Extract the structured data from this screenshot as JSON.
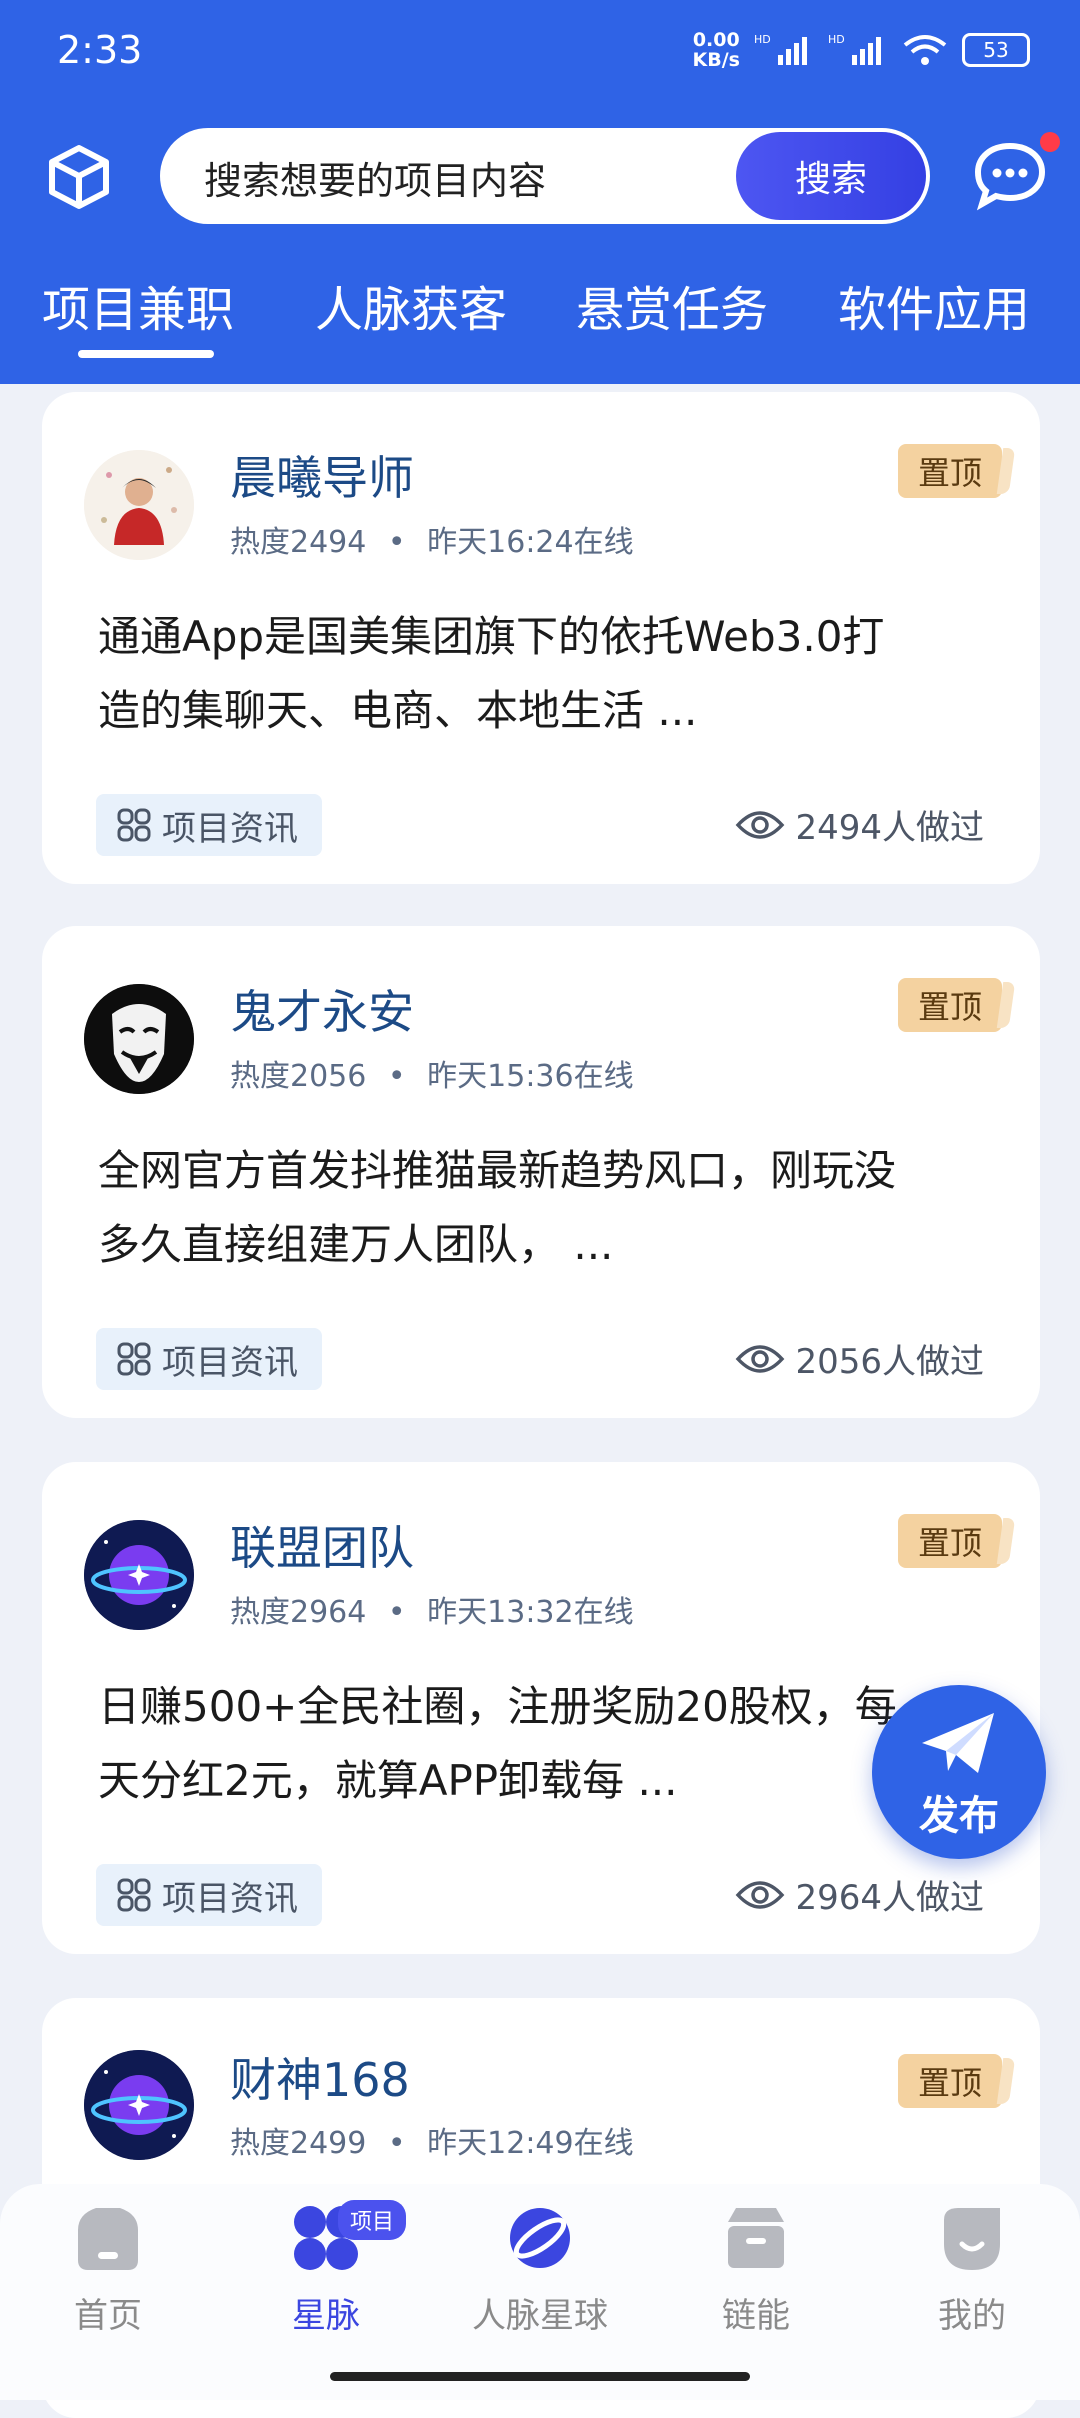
{
  "status_bar": {
    "time": "2:33",
    "net_speed_value": "0.00",
    "net_speed_unit": "KB/s",
    "signal1_label": "HD",
    "signal2_label": "HD",
    "battery": "53"
  },
  "search": {
    "placeholder": "搜索想要的项目内容",
    "button_label": "搜索"
  },
  "tabs": [
    "项目兼职",
    "人脉获客",
    "悬赏任务",
    "软件应用"
  ],
  "cards": [
    {
      "name": "晨曦导师",
      "heat": "热度2494",
      "separator": "•",
      "online": "昨天16:24在线",
      "pin": "置顶",
      "desc_line1": "通通App是国美集团旗下的依托Web3.0打",
      "desc_line2": "造的集聊天、电商、本地生活 ...",
      "tag": "项目资讯",
      "views": "2494人做过"
    },
    {
      "name": "鬼才永安",
      "heat": "热度2056",
      "separator": "•",
      "online": "昨天15:36在线",
      "pin": "置顶",
      "desc_line1": "全网官方首发抖推猫最新趋势风口，刚玩没",
      "desc_line2": "多久直接组建万人团队， ...",
      "tag": "项目资讯",
      "views": "2056人做过"
    },
    {
      "name": "联盟团队",
      "heat": "热度2964",
      "separator": "•",
      "online": "昨天13:32在线",
      "pin": "置顶",
      "desc_line1": "日赚500+全民社圈，注册奖励20股权，每",
      "desc_line2": "天分红2元，就算APP卸载每 ...",
      "tag": "项目资讯",
      "views": "2964人做过"
    },
    {
      "name": "财神168",
      "heat": "热度2499",
      "separator": "•",
      "online": "昨天12:49在线",
      "pin": "置顶"
    }
  ],
  "fab": {
    "label": "发布"
  },
  "bottom_nav": {
    "items": [
      {
        "label": "首页"
      },
      {
        "label": "星脉",
        "badge": "项目"
      },
      {
        "label": "人脉星球"
      },
      {
        "label": "链能"
      },
      {
        "label": "我的"
      }
    ],
    "active_index": 1
  },
  "colors": {
    "primary": "#2f63e6",
    "accent": "#3b46e0",
    "pin_bg": "#f4d2a0",
    "name_text": "#1c4a86"
  }
}
